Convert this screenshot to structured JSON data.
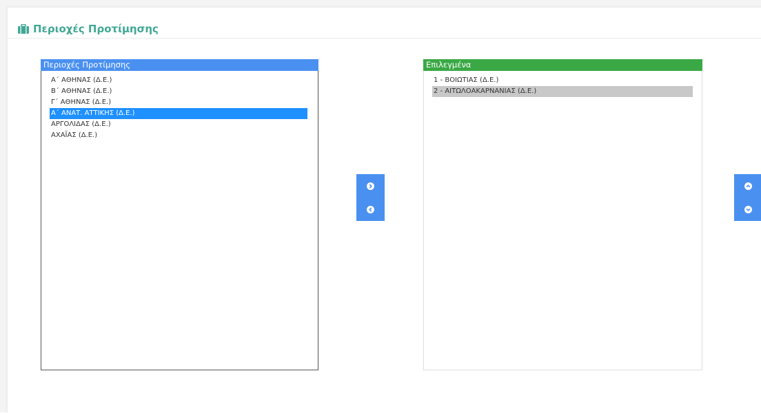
{
  "section": {
    "title": "Περιοχές Προτίμησης",
    "icon": "briefcase-icon",
    "accent_color": "#41a894"
  },
  "available_list": {
    "title": "Περιοχές Προτίμησης",
    "header_color": "#4a90f0",
    "items": [
      {
        "label": "Α΄ ΑΘΗΝΑΣ (Δ.Ε.)",
        "selected": false
      },
      {
        "label": "Β΄ ΑΘΗΝΑΣ (Δ.Ε.)",
        "selected": false
      },
      {
        "label": "Γ΄ ΑΘΗΝΑΣ (Δ.Ε.)",
        "selected": false
      },
      {
        "label": "Α΄ ΑΝΑΤ. ΑΤΤΙΚΗΣ (Δ.Ε.)",
        "selected": true
      },
      {
        "label": "ΑΡΓΟΛΙΔΑΣ (Δ.Ε.)",
        "selected": false
      },
      {
        "label": "ΑΧΑΪΑΣ (Δ.Ε.)",
        "selected": false
      }
    ]
  },
  "selected_list": {
    "title": "Επιλεγμένα",
    "header_color": "#3aa845",
    "items": [
      {
        "label": "1 - ΒΟΙΩΤΙΑΣ (Δ.Ε.)",
        "selected": false
      },
      {
        "label": "2 - ΑΙΤΩΛΟΑΚΑΡΝΑΝΙΑΣ (Δ.Ε.)",
        "selected": true
      }
    ]
  },
  "transfer_buttons": {
    "add_icon": "chevron-circle-right-icon",
    "remove_icon": "chevron-circle-left-icon"
  },
  "order_buttons": {
    "up_icon": "chevron-circle-up-icon",
    "down_icon": "chevron-circle-down-icon"
  }
}
